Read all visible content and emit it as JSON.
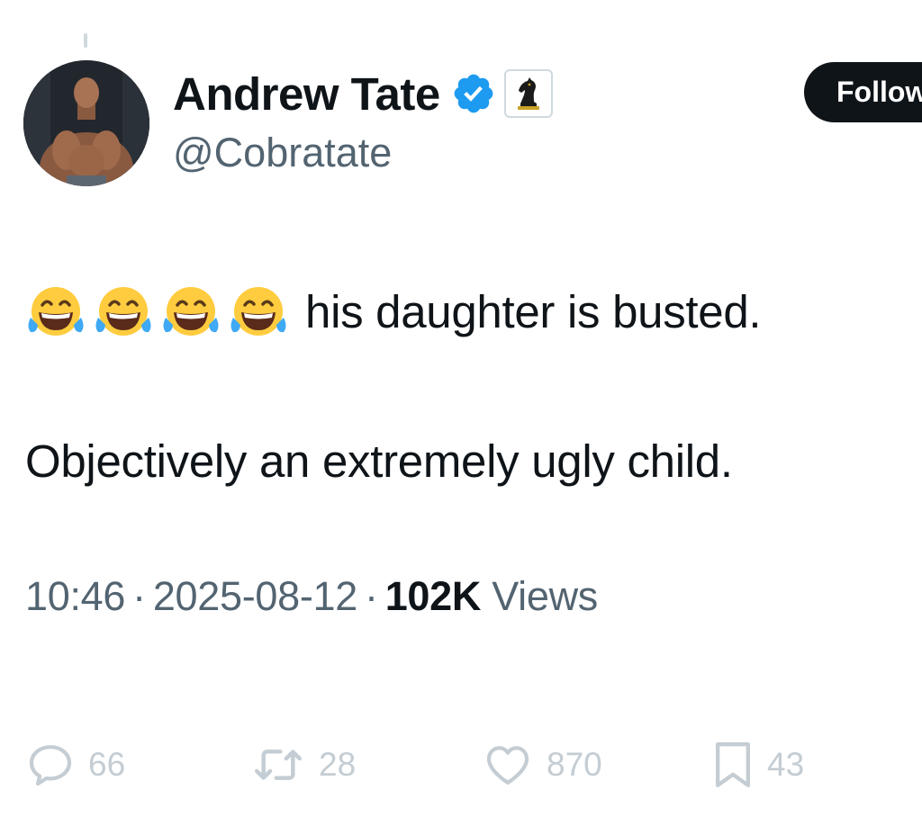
{
  "tweet": {
    "author": {
      "display_name": "Andrew Tate",
      "handle": "@Cobratate",
      "verified": true,
      "affiliate_badge_icon": "chess-knight-icon"
    },
    "follow_label": "Follow",
    "emoji_icon": "face-with-tears-of-joy",
    "emoji_count": 4,
    "text_line1": "his daughter is busted.",
    "text_line2": "Objectively an extremely ugly child.",
    "time": "10:46",
    "date": "2025-08-12",
    "separator": "·",
    "views_count": "102K",
    "views_label": "Views"
  },
  "actions": {
    "reply_count": "66",
    "retweet_count": "28",
    "like_count": "870",
    "bookmark_count": "43"
  },
  "colors": {
    "text_primary": "#0f1419",
    "text_secondary": "#536471",
    "verified_blue": "#1d9bf0",
    "action_gray": "#c4cdd3"
  }
}
